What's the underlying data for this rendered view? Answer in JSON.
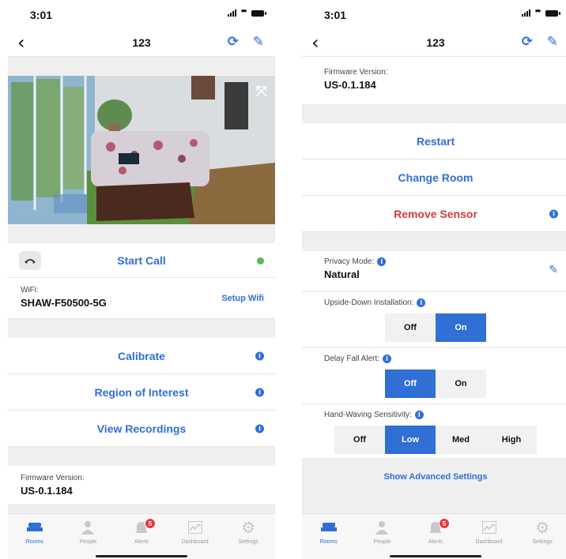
{
  "status_bar": {
    "time": "3:01"
  },
  "nav": {
    "title": "123"
  },
  "left": {
    "call": {
      "label": "Start Call",
      "status_color": "#5cb85c"
    },
    "wifi": {
      "label": "WiFi:",
      "value": "SHAW-F50500-5G",
      "setup_label": "Setup Wifi"
    },
    "actions": [
      {
        "label": "Calibrate"
      },
      {
        "label": "Region of Interest"
      },
      {
        "label": "View Recordings"
      }
    ],
    "firmware": {
      "label": "Firmware Version:",
      "value": "US-0.1.184"
    }
  },
  "right": {
    "firmware": {
      "label": "Firmware Version:",
      "value": "US-0.1.184"
    },
    "actions": {
      "restart": "Restart",
      "change_room": "Change Room",
      "remove_sensor": "Remove Sensor"
    },
    "privacy": {
      "label": "Privacy Mode:",
      "value": "Natural"
    },
    "upside_down": {
      "label": "Upside-Down Installation:",
      "options": [
        "Off",
        "On"
      ],
      "selected": "On"
    },
    "delay_fall": {
      "label": "Delay Fall Alert:",
      "options": [
        "Off",
        "On"
      ],
      "selected": "Off"
    },
    "hand_waving": {
      "label": "Hand-Waving Sensitivity:",
      "options": [
        "Off",
        "Low",
        "Med",
        "High"
      ],
      "selected": "Low"
    },
    "advanced_label": "Show Advanced Settings"
  },
  "tabs": [
    {
      "label": "Rooms",
      "icon": "bed-icon",
      "active": true
    },
    {
      "label": "People",
      "icon": "person-icon"
    },
    {
      "label": "Alerts",
      "icon": "bell-icon",
      "badge": "5"
    },
    {
      "label": "Dashboard",
      "icon": "chart-icon"
    },
    {
      "label": "Settings",
      "icon": "gear-icon"
    }
  ],
  "colors": {
    "accent": "#2f6fd6",
    "danger": "#d53a3a",
    "online": "#5cb85c",
    "badge": "#e53b3b"
  }
}
